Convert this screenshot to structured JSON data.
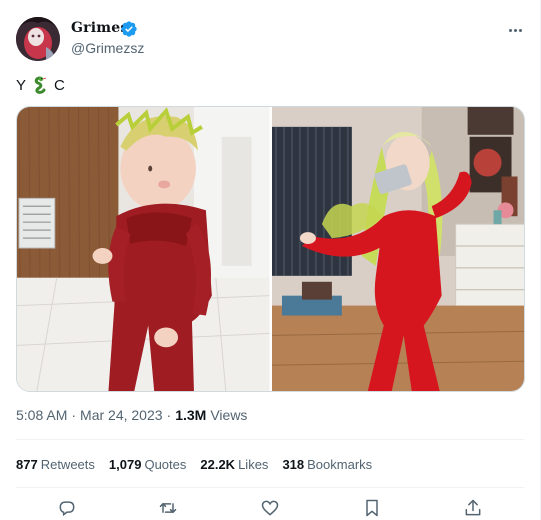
{
  "author": {
    "display_name": "Grimes",
    "handle": "@Grimezsz",
    "verified_icon": "verified-badge-icon",
    "avatar_icon": "avatar"
  },
  "tweet": {
    "text_before": "Y",
    "emoji": "green-serpent-emoji",
    "text_after": "C"
  },
  "media": {
    "images": [
      "toddler-in-red-outfit-photo",
      "woman-in-red-jumpsuit-photo"
    ]
  },
  "meta": {
    "time": "5:08 AM",
    "separator": "·",
    "date": "Mar 24, 2023",
    "views_count": "1.3M",
    "views_label": "Views"
  },
  "stats": [
    {
      "count": "877",
      "label": "Retweets"
    },
    {
      "count": "1,079",
      "label": "Quotes"
    },
    {
      "count": "22.2K",
      "label": "Likes"
    },
    {
      "count": "318",
      "label": "Bookmarks"
    }
  ],
  "actions": [
    "reply-icon",
    "retweet-icon",
    "like-icon",
    "bookmark-icon",
    "share-icon"
  ],
  "colors": {
    "verified": "#1d9bf0",
    "text": "#0f1419",
    "secondary": "#536471",
    "border": "#cfd9de"
  }
}
